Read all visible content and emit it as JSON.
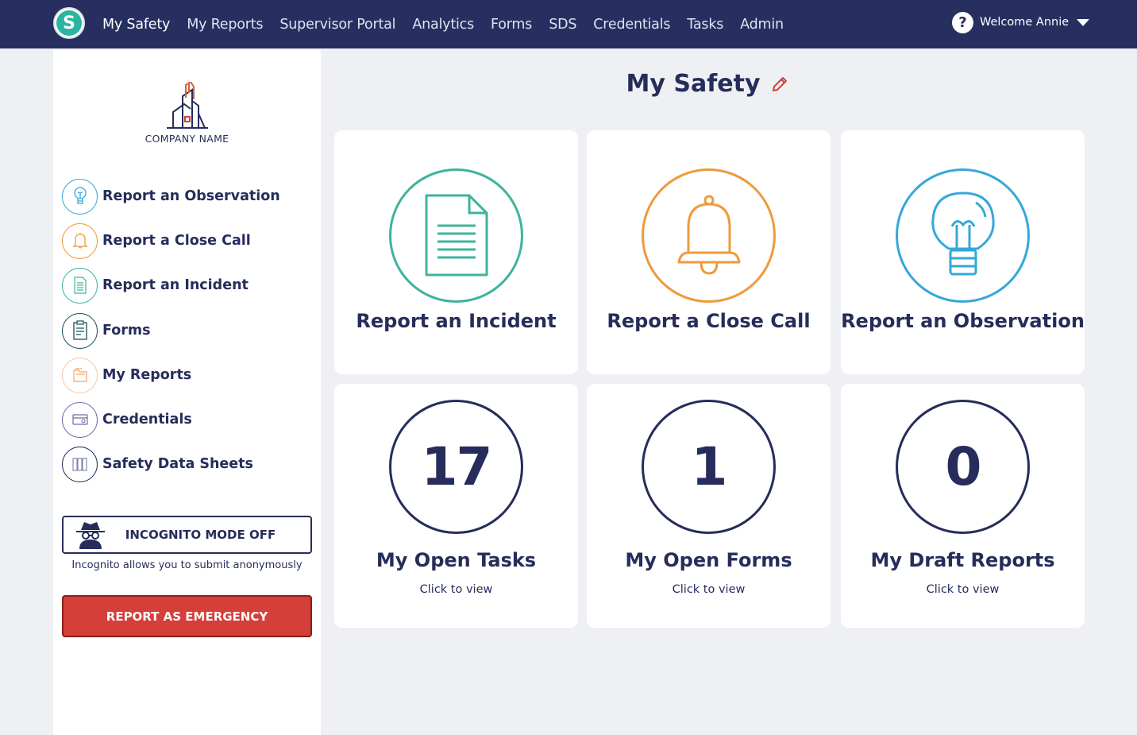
{
  "nav": {
    "logo_letter": "S",
    "items": [
      "My Safety",
      "My Reports",
      "Supervisor Portal",
      "Analytics",
      "Forms",
      "SDS",
      "Credentials",
      "Tasks",
      "Admin"
    ],
    "welcome": "Welcome Annie",
    "help_glyph": "?"
  },
  "sidebar": {
    "company_name": "COMPANY NAME",
    "items": [
      {
        "label": "Report an Observation",
        "icon": "lightbulb-icon",
        "color": "#35a8d8"
      },
      {
        "label": "Report a Close Call",
        "icon": "bell-icon",
        "color": "#ef9a3c"
      },
      {
        "label": "Report an Incident",
        "icon": "document-icon",
        "color": "#3fb39c"
      },
      {
        "label": "Forms",
        "icon": "clipboard-icon",
        "color": "#1f4f5a"
      },
      {
        "label": "My Reports",
        "icon": "folder-icon",
        "color": "#f2a36b"
      },
      {
        "label": "Credentials",
        "icon": "id-card-icon",
        "color": "#7b64a6"
      },
      {
        "label": "Safety Data Sheets",
        "icon": "binders-icon",
        "color": "#262d5b"
      }
    ],
    "incognito_label": "INCOGNITO MODE OFF",
    "incognito_note": "Incognito allows you to submit anonymously",
    "emergency_label": "REPORT AS EMERGENCY"
  },
  "main": {
    "title": "My Safety",
    "action_cards": [
      {
        "label": "Report an Incident",
        "icon": "document-icon",
        "color": "#3fb39c"
      },
      {
        "label": "Report a Close Call",
        "icon": "bell-icon",
        "color": "#ef9a3c"
      },
      {
        "label": "Report an Observation",
        "icon": "lightbulb-icon",
        "color": "#35a8d8"
      }
    ],
    "stat_cards": [
      {
        "count": "17",
        "label": "My Open Tasks",
        "sub": "Click to view"
      },
      {
        "count": "1",
        "label": "My Open Forms",
        "sub": "Click to view"
      },
      {
        "count": "0",
        "label": "My Draft Reports",
        "sub": "Click to view"
      }
    ]
  },
  "colors": {
    "nav_bg": "#262f60",
    "accent_navy": "#262d5b",
    "emergency": "#d43f3a"
  }
}
